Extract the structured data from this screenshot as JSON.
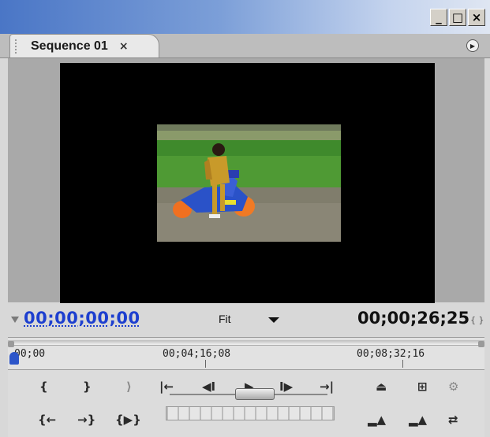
{
  "window": {
    "minimize_label": "_",
    "maximize_label": "□",
    "close_label": "×"
  },
  "tab": {
    "label": "Sequence 01",
    "close_label": "×"
  },
  "panel_menu_icon": "panel-menu-icon",
  "timecode": {
    "current": "00;00;00;00",
    "zoom": "Fit",
    "duration": "00;00;26;25"
  },
  "ruler": {
    "labels": [
      "00;00",
      "00;04;16;08",
      "00;08;32;16"
    ]
  },
  "controls": {
    "row1": [
      "{",
      "}",
      "⟩",
      "|←",
      "◀I",
      "▶",
      "I▶",
      "→|",
      "⏏",
      "⊞",
      "⚙"
    ],
    "row2": [
      "{←",
      "→}",
      "{▶}"
    ],
    "right2": [
      "▂▲",
      "▂▲",
      "⇄"
    ]
  },
  "colors": {
    "timecode_blue": "#1d3fcf",
    "screen": "#000000",
    "panel": "#a9a9a9"
  }
}
